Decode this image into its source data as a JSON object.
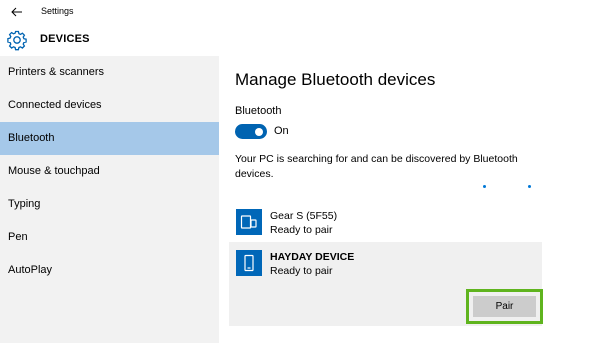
{
  "window": {
    "app_title": "Settings"
  },
  "header": {
    "title": "DEVICES"
  },
  "sidebar": {
    "items": [
      {
        "label": "Printers & scanners"
      },
      {
        "label": "Connected devices"
      },
      {
        "label": "Bluetooth"
      },
      {
        "label": "Mouse & touchpad"
      },
      {
        "label": "Typing"
      },
      {
        "label": "Pen"
      },
      {
        "label": "AutoPlay"
      }
    ],
    "active_index": 2
  },
  "main": {
    "title": "Manage Bluetooth devices",
    "bluetooth_label": "Bluetooth",
    "toggle_state": "On",
    "description": "Your PC is searching for and can be discovered by Bluetooth devices.",
    "devices": [
      {
        "name": "Gear S (5F55)",
        "status": "Ready to pair",
        "icon": "phone-and-watch-icon"
      },
      {
        "name": "HAYDAY DEVICE",
        "status": "Ready to pair",
        "icon": "phone-icon",
        "pair_label": "Pair"
      }
    ]
  },
  "colors": {
    "accent": "#0063b1",
    "sidebar_active": "#a5c8e9",
    "sidebar_bg": "#f2f2f2",
    "highlight_frame": "#5fb41e",
    "button_bg": "#cccccc"
  }
}
